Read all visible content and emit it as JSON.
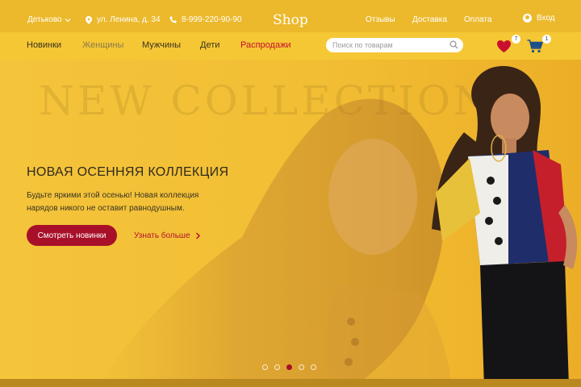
{
  "topbar": {
    "city": "Детьково",
    "address": "ул. Ленина, д. 34",
    "phone": "8-999-220-90-90",
    "logo": "Shop",
    "links": [
      "Отзывы",
      "Доставка",
      "Оплата"
    ],
    "login": "Вход"
  },
  "nav": {
    "items": [
      "Новинки",
      "Женщины",
      "Мужчины",
      "Дети",
      "Распродажи"
    ],
    "search_placeholder": "Поиск по товарам",
    "favorites_count": "7",
    "cart_count": "1"
  },
  "hero": {
    "background_word": "NEW COLLECTION",
    "title": "НОВАЯ ОСЕННЯЯ КОЛЛЕКЦИЯ",
    "text": "Будьте яркими этой осенью! Новая коллекция нарядов никого не оставит равнодушным.",
    "primary_button": "Смотреть новинки",
    "more_link": "Узнать больше",
    "slides_total": 5,
    "active_slide": 3
  },
  "colors": {
    "accent": "#a8102a",
    "sale": "#c8102e",
    "background": "#f2c232"
  }
}
